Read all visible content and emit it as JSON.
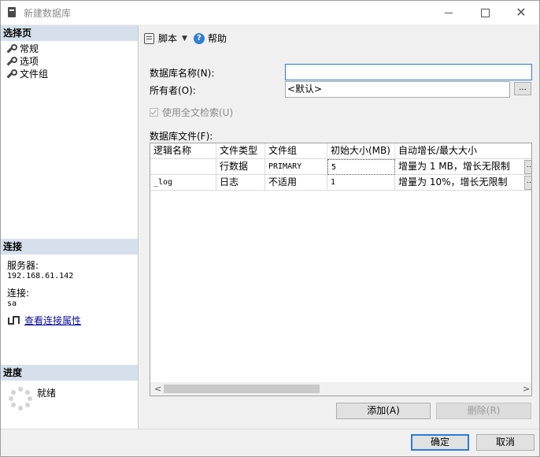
{
  "window": {
    "title": "新建数据库"
  },
  "left": {
    "select_page_header": "选择页",
    "pages": [
      "常规",
      "选项",
      "文件组"
    ],
    "connection_header": "连接",
    "server_label": "服务器:",
    "server_value": "192.168.61.142",
    "connection_label": "连接:",
    "connection_value": "sa",
    "view_conn_props": "查看连接属性",
    "progress_header": "进度",
    "progress_status": "就绪"
  },
  "toolbar": {
    "script": "脚本",
    "help": "帮助"
  },
  "form": {
    "db_name_label": "数据库名称(N):",
    "db_name_value": "",
    "owner_label": "所有者(O):",
    "owner_value": "<默认>",
    "owner_browse": "...",
    "fulltext_label": "使用全文检索(U)",
    "files_label": "数据库文件(F):"
  },
  "grid": {
    "headers": [
      "逻辑名称",
      "文件类型",
      "文件组",
      "初始大小(MB)",
      "自动增长/最大大小"
    ],
    "rows": [
      [
        "",
        "行数据",
        "PRIMARY",
        "5",
        "增量为 1 MB，增长无限制"
      ],
      [
        "_log",
        "日志",
        "不适用",
        "1",
        "增量为 10%，增长无限制"
      ]
    ]
  },
  "buttons": {
    "add": "添加(A)",
    "remove": "删除(R)",
    "ok": "确定",
    "cancel": "取消"
  }
}
